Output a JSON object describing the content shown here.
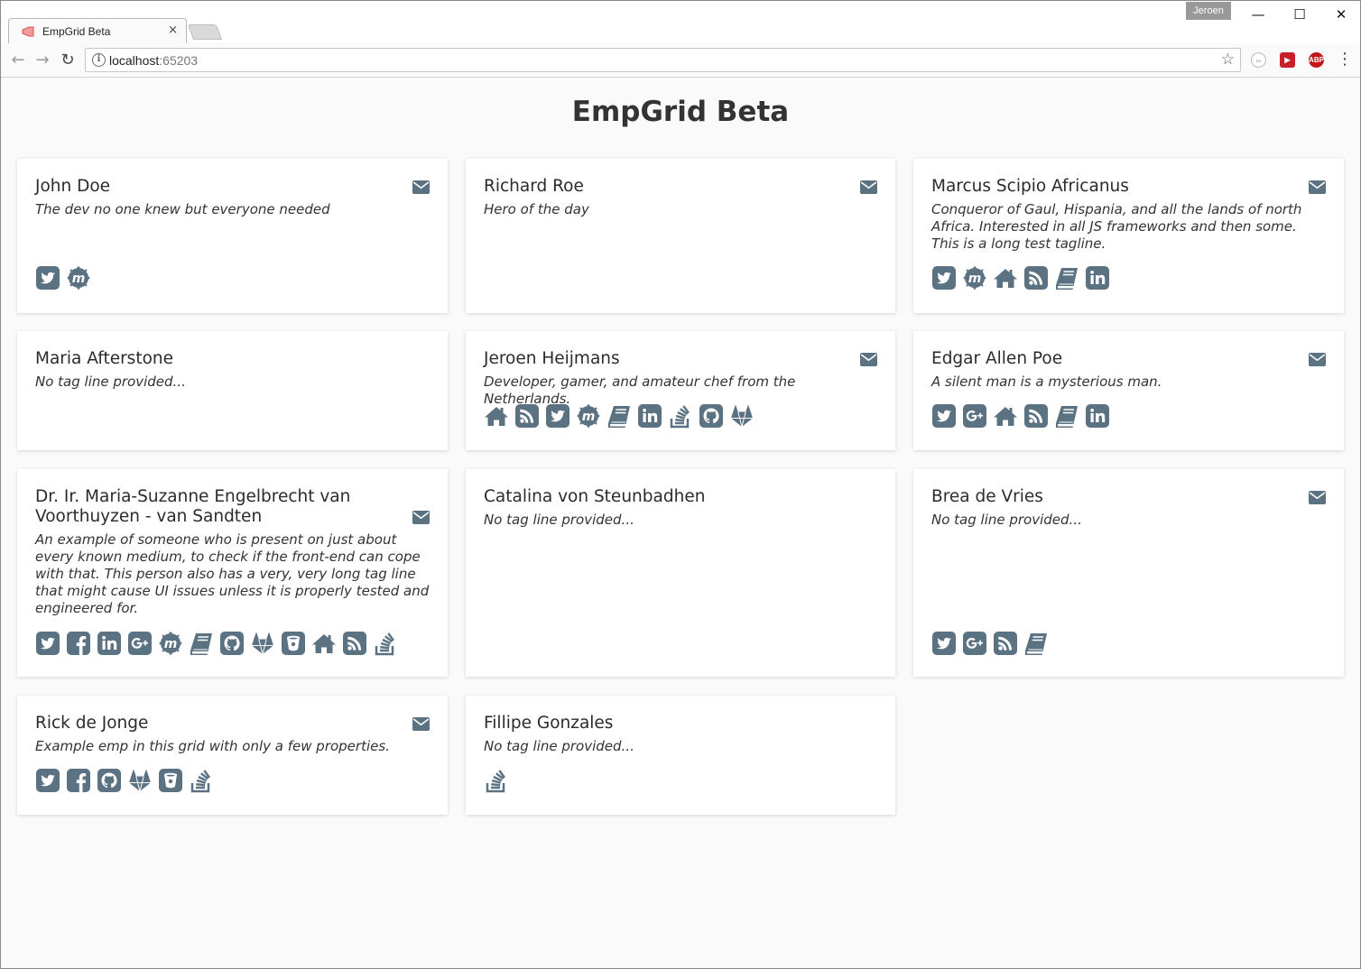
{
  "browser": {
    "tab_title": "EmpGrid Beta",
    "tab_close": "×",
    "profile_name": "Jeroen",
    "url_host": "localhost",
    "url_port": ":65203",
    "window_controls": {
      "minimize": "—",
      "maximize": "☐",
      "close": "✕"
    }
  },
  "page": {
    "title": "EmpGrid Beta"
  },
  "cards": [
    {
      "name": "John Doe",
      "tagline": "The dev no one knew but everyone needed",
      "has_email": true,
      "icons": [
        "twitter-icon",
        "meetup-icon"
      ]
    },
    {
      "name": "Richard Roe",
      "tagline": "Hero of the day",
      "has_email": true,
      "icons": []
    },
    {
      "name": "Marcus Scipio Africanus",
      "tagline": "Conqueror of Gaul, Hispania, and all the lands of north Africa. Interested in all JS frameworks and then some. This is a long test tagline.",
      "has_email": true,
      "icons": [
        "twitter-icon",
        "meetup-icon",
        "home-icon",
        "rss-icon",
        "book-icon",
        "linkedin-icon"
      ]
    },
    {
      "name": "Maria Afterstone",
      "tagline": "No tag line provided...",
      "has_email": false,
      "icons": []
    },
    {
      "name": "Jeroen Heijmans",
      "tagline": "Developer, gamer, and amateur chef from the Netherlands.",
      "has_email": true,
      "icons": [
        "home-icon",
        "rss-icon",
        "twitter-icon",
        "meetup-icon",
        "book-icon",
        "linkedin-icon",
        "stackoverflow-icon",
        "github-icon",
        "gitlab-icon"
      ]
    },
    {
      "name": "Edgar Allen Poe",
      "tagline": "A silent man is a mysterious man.",
      "has_email": true,
      "icons": [
        "twitter-icon",
        "googleplus-icon",
        "home-icon",
        "rss-icon",
        "book-icon",
        "linkedin-icon"
      ]
    },
    {
      "name": "Dr. Ir. Maria-Suzanne Engelbrecht van Voorthuyzen - van Sandten",
      "tagline": "An example of someone who is present on just about every known medium, to check if the front-end can cope with that. This person also has a very, very long tag line that might cause UI issues unless it is properly tested and engineered for.",
      "has_email": true,
      "icons": [
        "twitter-icon",
        "facebook-icon",
        "linkedin-icon",
        "googleplus-icon",
        "meetup-icon",
        "book-icon",
        "github-icon",
        "gitlab-icon",
        "bitbucket-icon",
        "home-icon",
        "rss-icon",
        "stackoverflow-icon"
      ]
    },
    {
      "name": "Catalina von Steunbadhen",
      "tagline": "No tag line provided...",
      "has_email": false,
      "icons": []
    },
    {
      "name": "Brea de Vries",
      "tagline": "No tag line provided...",
      "has_email": true,
      "icons": [
        "twitter-icon",
        "googleplus-icon",
        "rss-icon",
        "book-icon"
      ]
    },
    {
      "name": "Rick de Jonge",
      "tagline": "Example emp in this grid with only a few properties.",
      "has_email": true,
      "icons": [
        "twitter-icon",
        "facebook-icon",
        "github-icon",
        "gitlab-icon",
        "bitbucket-icon",
        "stackoverflow-icon"
      ]
    },
    {
      "name": "Fillipe Gonzales",
      "tagline": "No tag line provided...",
      "has_email": false,
      "icons": [
        "stackoverflow-icon"
      ]
    }
  ],
  "colors": {
    "icon": "#5a7282",
    "page_bg": "#fafafa",
    "card_bg": "#ffffff",
    "text": "#333333"
  }
}
